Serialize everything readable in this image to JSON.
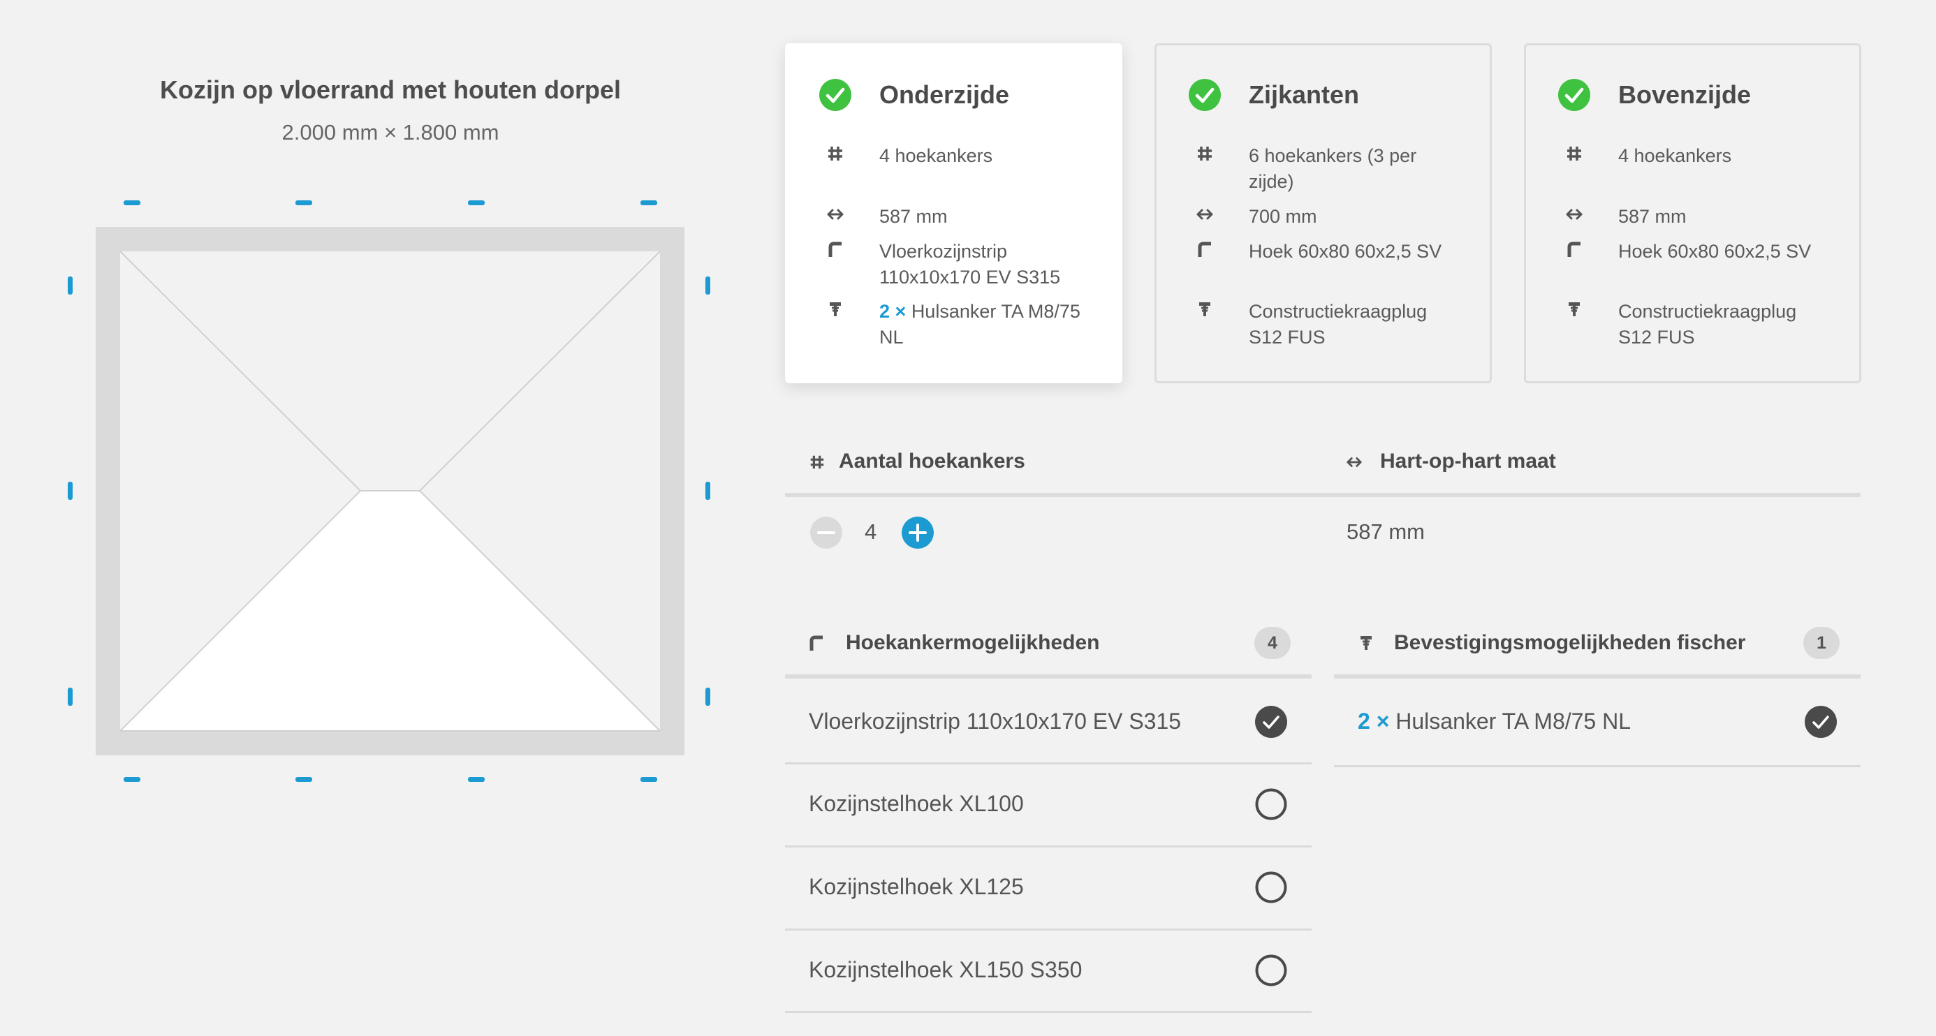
{
  "frame": {
    "title": "Kozijn op vloerrand met houten dorpel",
    "dimensions": "2.000 mm × 1.800 mm"
  },
  "cards": [
    {
      "title": "Onderzijde",
      "active": true,
      "count": "4 hoekankers",
      "spacing": "587 mm",
      "anchor": "Vloerkozijnstrip 110x10x170 EV S315",
      "fixing_qty": "2 ×",
      "fixing": "Hulsanker TA M8/75 NL"
    },
    {
      "title": "Zijkanten",
      "active": false,
      "count": "6 hoekankers (3 per zijde)",
      "spacing": "700 mm",
      "anchor": "Hoek 60x80 60x2,5 SV",
      "fixing_qty": "",
      "fixing": "Constructiekraagplug S12 FUS"
    },
    {
      "title": "Bovenzijde",
      "active": false,
      "count": "4 hoekankers",
      "spacing": "587 mm",
      "anchor": "Hoek 60x80 60x2,5 SV",
      "fixing_qty": "",
      "fixing": "Constructiekraagplug S12 FUS"
    }
  ],
  "quantity": {
    "count_label": "Aantal hoekankers",
    "count_value": "4",
    "spacing_label": "Hart-op-hart maat",
    "spacing_value": "587 mm"
  },
  "anchor_options": {
    "title": "Hoekankermogelijkheden",
    "badge": "4",
    "items": [
      {
        "label": "Vloerkozijnstrip 110x10x170 EV S315",
        "selected": true
      },
      {
        "label": "Kozijnstelhoek XL100",
        "selected": false
      },
      {
        "label": "Kozijnstelhoek XL125",
        "selected": false
      },
      {
        "label": "Kozijnstelhoek XL150 S350",
        "selected": false
      }
    ]
  },
  "fixing_options": {
    "title": "Bevestigingsmogelijkheden fischer",
    "badge": "1",
    "items": [
      {
        "qty": "2 ×",
        "label": "Hulsanker TA M8/75 NL",
        "selected": true
      }
    ]
  },
  "colors": {
    "accent_blue": "#1b9bd1",
    "success_green": "#3fc23f",
    "background": "#f2f2f2",
    "frame_gray": "#dadada"
  },
  "icons": {
    "card_status": "check-circle-icon",
    "count": "hash-icon",
    "spacing": "double-arrow-icon",
    "anchor": "angle-bracket-icon",
    "fixing": "anchor-bolt-icon",
    "decrease": "minus-circle-icon",
    "increase": "plus-circle-icon",
    "selected": "checked-circle-icon",
    "unselected": "empty-circle-icon"
  }
}
